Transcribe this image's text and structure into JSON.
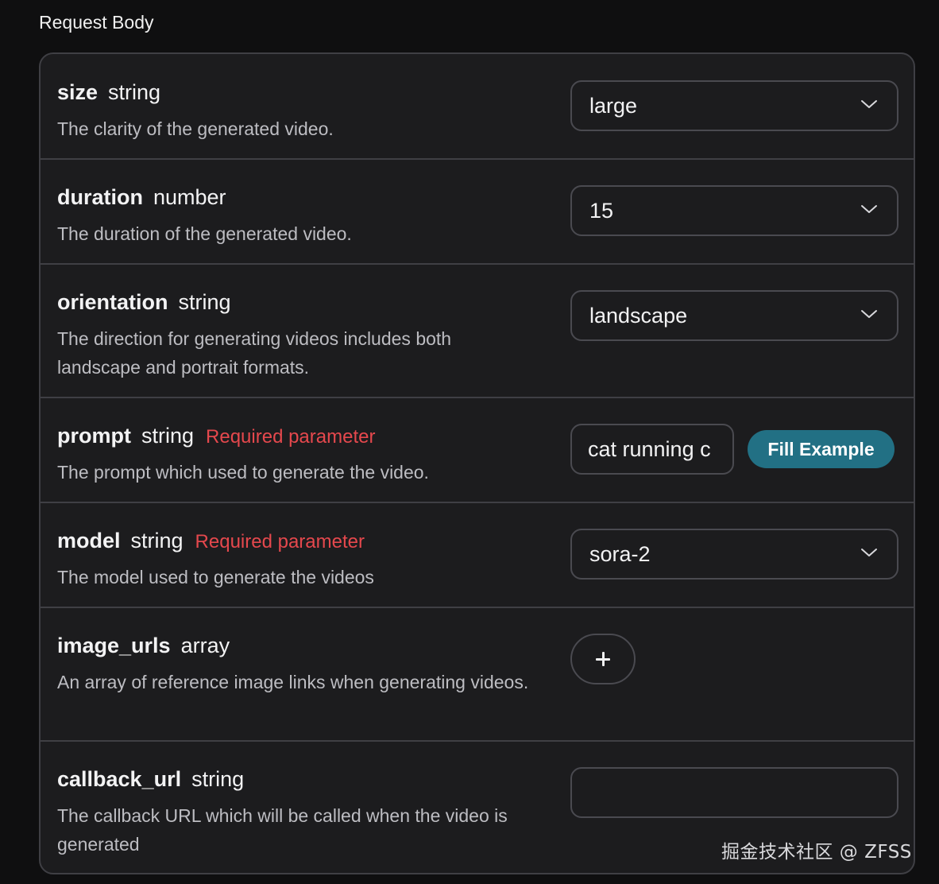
{
  "section": {
    "title": "Request Body"
  },
  "params": {
    "size": {
      "name": "size",
      "type": "string",
      "description": "The clarity of the generated video.",
      "value": "large"
    },
    "duration": {
      "name": "duration",
      "type": "number",
      "description": "The duration of the generated video.",
      "value": "15"
    },
    "orientation": {
      "name": "orientation",
      "type": "string",
      "description": "The direction for generating videos includes both landscape and portrait formats.",
      "value": "landscape"
    },
    "prompt": {
      "name": "prompt",
      "type": "string",
      "required_label": "Required parameter",
      "description": "The prompt which used to generate the video.",
      "value": "cat running c",
      "fill_example_label": "Fill Example"
    },
    "model": {
      "name": "model",
      "type": "string",
      "required_label": "Required parameter",
      "description": "The model used to generate the videos",
      "value": "sora-2"
    },
    "image_urls": {
      "name": "image_urls",
      "type": "array",
      "description": "An array of reference image links when generating videos.",
      "add_label": "+"
    },
    "callback_url": {
      "name": "callback_url",
      "type": "string",
      "description": "The callback URL which will be called when the video is generated",
      "value": ""
    }
  },
  "icons": {
    "select_chevron": "chevron-down-icon",
    "add": "plus-icon"
  },
  "colors": {
    "required": "#e5484d",
    "fill_button": "#227084",
    "panel_bg": "#1c1c1e",
    "border": "#3f3f44"
  },
  "watermark": "掘金技术社区 @ ZFSS"
}
